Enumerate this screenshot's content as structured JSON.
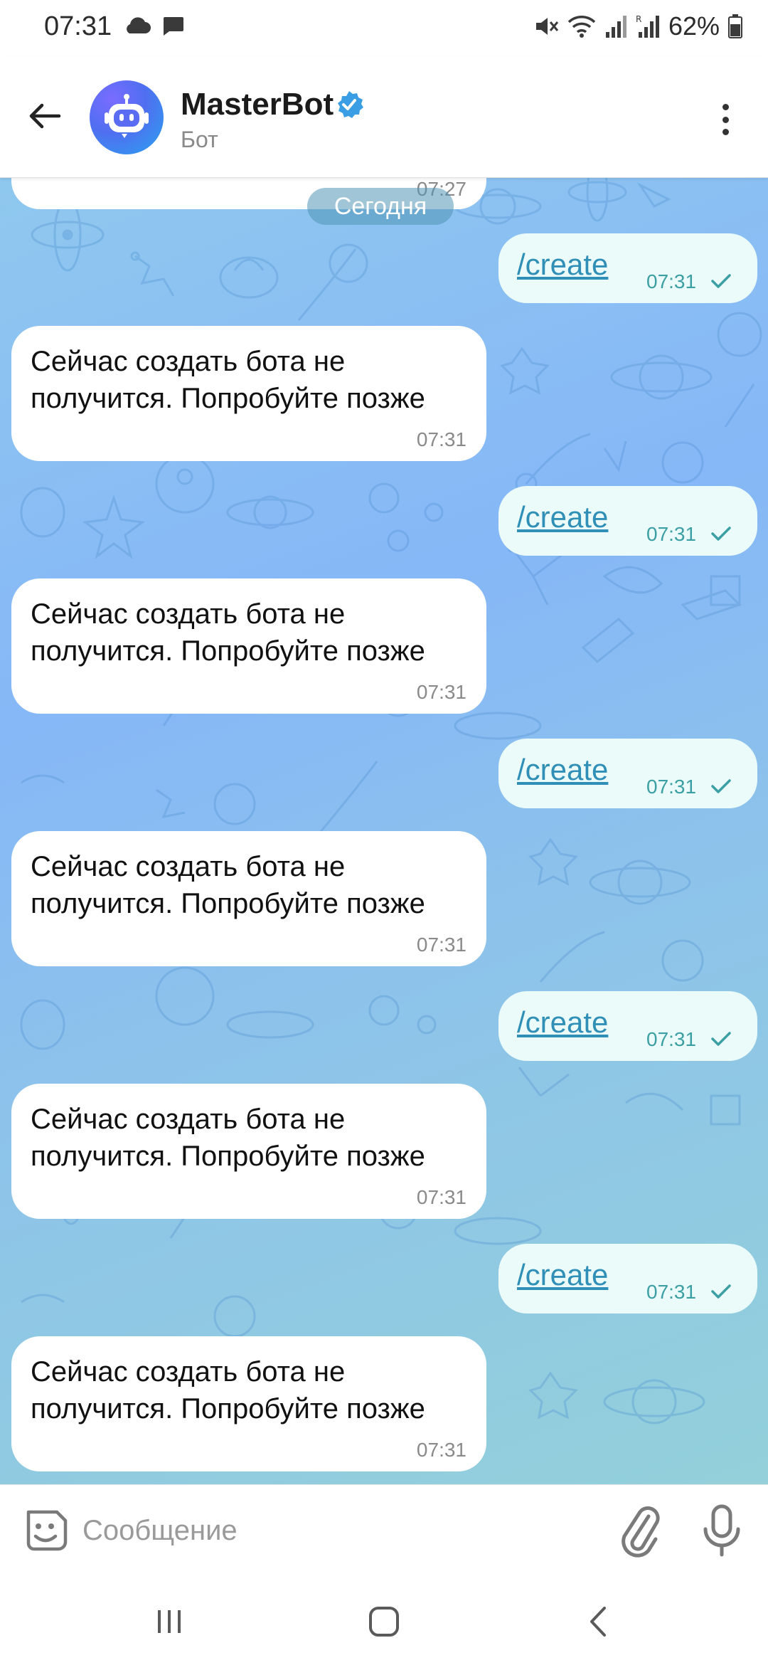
{
  "status_bar": {
    "time": "07:31",
    "battery": "62%",
    "icons": [
      "cloud-icon",
      "message-icon",
      "mute-icon",
      "wifi-icon",
      "signal-icon",
      "signal-r-icon",
      "battery-icon"
    ]
  },
  "header": {
    "name": "MasterBot",
    "subtitle": "Бот",
    "icons": [
      "back-arrow-icon",
      "bot-avatar-icon",
      "verified-icon",
      "more-vert-icon"
    ]
  },
  "chat": {
    "previous_time": "07:27",
    "date_chip": "Сегодня",
    "outgoing_text": "/create",
    "messages": [
      {
        "type": "out",
        "text": "/create",
        "time": "07:31"
      },
      {
        "type": "in",
        "line1": "Сейчас создать бота не",
        "line2": "получится. Попробуйте позже",
        "time": "07:31"
      },
      {
        "type": "out",
        "text": "/create",
        "time": "07:31"
      },
      {
        "type": "in",
        "line1": "Сейчас создать бота не",
        "line2": "получится. Попробуйте позже",
        "time": "07:31"
      },
      {
        "type": "out",
        "text": "/create",
        "time": "07:31"
      },
      {
        "type": "in",
        "line1": "Сейчас создать бота не",
        "line2": "получится. Попробуйте позже",
        "time": "07:31"
      },
      {
        "type": "out",
        "text": "/create",
        "time": "07:31"
      },
      {
        "type": "in",
        "line1": "Сейчас создать бота не",
        "line2": "получится. Попробуйте позже",
        "time": "07:31"
      },
      {
        "type": "out",
        "text": "/create",
        "time": "07:31"
      },
      {
        "type": "in",
        "line1": "Сейчас создать бота не",
        "line2": "получится. Попробуйте позже",
        "time": "07:31"
      }
    ]
  },
  "input": {
    "placeholder": "Сообщение",
    "value": "",
    "icons": [
      "sticker-icon",
      "paperclip-icon",
      "microphone-icon"
    ]
  },
  "nav": {
    "icons": [
      "recent-apps-icon",
      "home-icon",
      "back-icon"
    ]
  },
  "colors": {
    "accent": "#2f8fb6",
    "outgoing_bubble": "#ebfbf9",
    "incoming_bubble": "#ffffff",
    "verified": "#3a9ee4"
  }
}
